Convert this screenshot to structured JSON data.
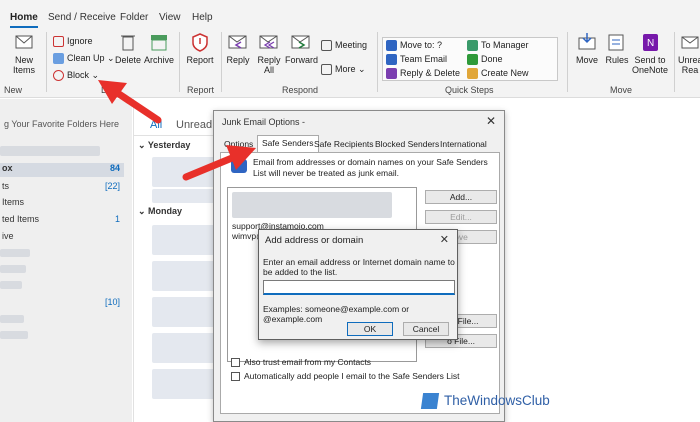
{
  "tabs": [
    "Home",
    "Send / Receive",
    "Folder",
    "View",
    "Help"
  ],
  "ribbon": {
    "new_items_label": "New Items",
    "group_new": "New",
    "ignore": "Ignore",
    "clean_up": "Clean Up",
    "block": "Block",
    "delete": "Delete",
    "archive": "Archive",
    "report": "Report",
    "group_report": "Report",
    "reply": "Reply",
    "reply_all": "Reply All",
    "forward": "Forward",
    "meeting": "Meeting",
    "more": "More",
    "group_respond": "Respond",
    "quick_steps": [
      "Move to: ?",
      "Team Email",
      "Reply & Delete",
      "To Manager",
      "Done",
      "Create New"
    ],
    "group_quick_steps": "Quick Steps",
    "move": "Move",
    "rules": "Rules",
    "send_to_onenote": "Send to OneNote",
    "group_move": "Move",
    "unread": "Unrea Rea",
    "partial_d": "D"
  },
  "left_pane": {
    "favorites_hint": "g Your Favorite Folders Here",
    "folders": [
      {
        "label": "ox",
        "count": "84"
      },
      {
        "label": "ts",
        "count": "[22]"
      },
      {
        "label": "Items",
        "count": ""
      },
      {
        "label": "ted Items",
        "count": "1"
      },
      {
        "label": "ive",
        "count": ""
      }
    ],
    "extra_count": "[10]"
  },
  "message_list": {
    "filter_all": "All",
    "filter_unread": "Unread",
    "group_yesterday": "Yesterday",
    "group_monday": "Monday"
  },
  "junk_dialog": {
    "title": "Junk Email Options -",
    "tabs": [
      "Options",
      "Safe Senders",
      "Safe Recipients",
      "Blocked Senders",
      "International"
    ],
    "description": "Email from addresses or domain names on your Safe Senders List will never be treated as junk email.",
    "list_items": [
      "support@instamojo.com",
      "wimvp@"
    ],
    "buttons": [
      "Add...",
      "Edit...",
      "Remove",
      "Add from File...",
      "Export to File..."
    ],
    "button_visible_text": [
      "Add...",
      "Edit...",
      "ove",
      "om File...",
      "o File..."
    ],
    "check_contacts": "Also trust email from my Contacts",
    "check_auto_add": "Automatically add people I email to the Safe Senders List"
  },
  "add_dialog": {
    "title": "Add address or domain",
    "prompt": "Enter an email address or Internet domain name to be added to the list.",
    "input_value": "",
    "example": "Examples: someone@example.com or @example.com",
    "ok": "OK",
    "cancel": "Cancel"
  },
  "watermark": "TheWindowsClub",
  "colors": {
    "accent": "#0f6cbd",
    "arrow": "#e8302a",
    "ribbon_bg": "#f3f3f3"
  }
}
